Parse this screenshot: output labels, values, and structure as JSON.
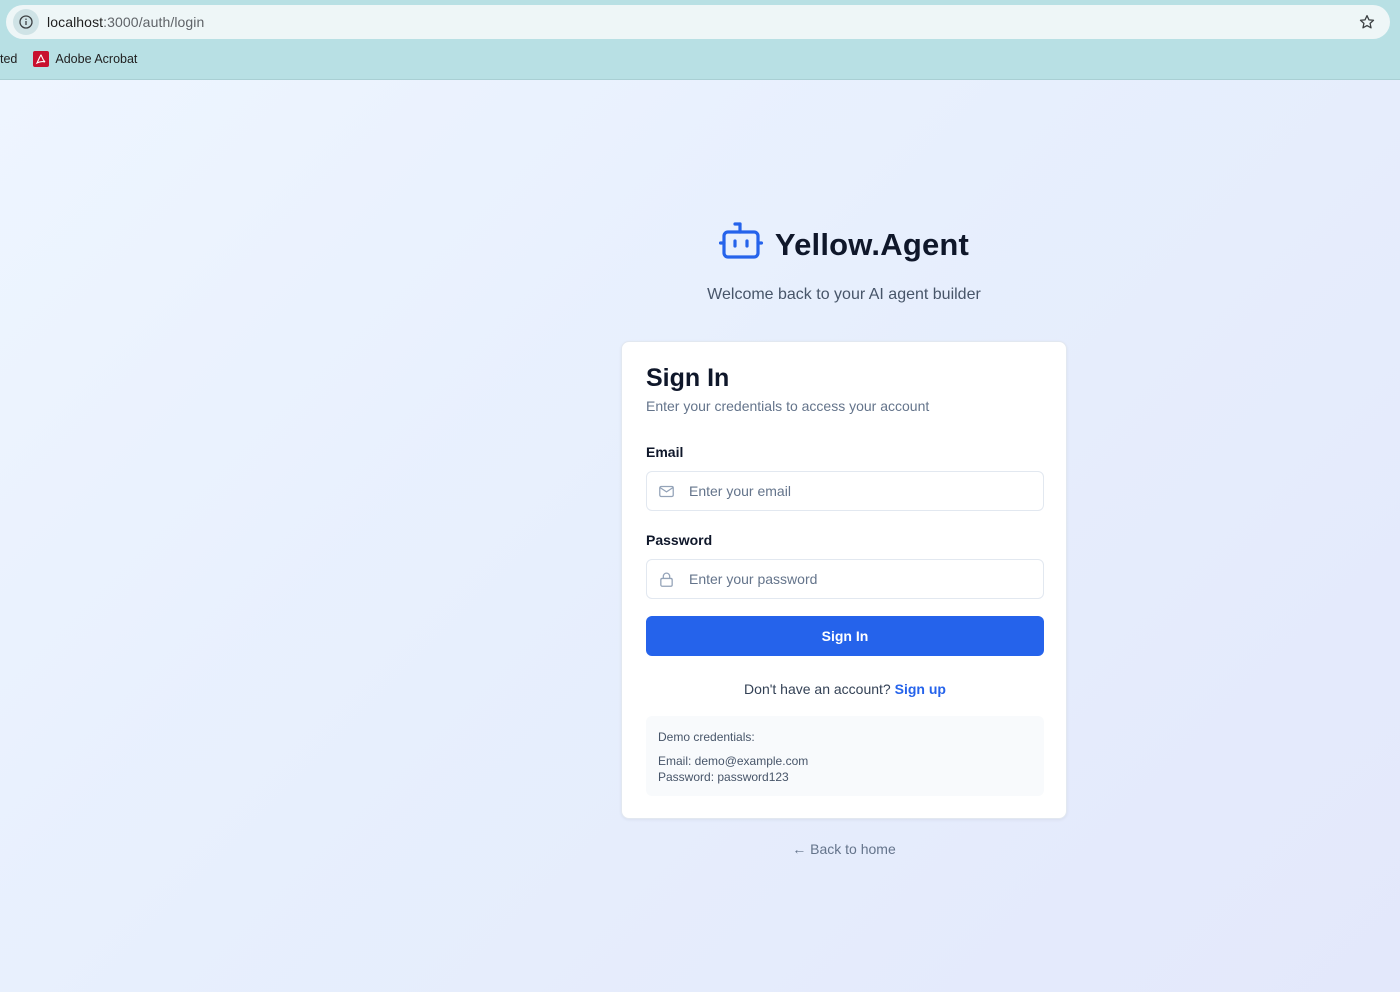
{
  "browser": {
    "url_host": "localhost",
    "url_path": ":3000/auth/login",
    "bookmarks": [
      {
        "label": "ted"
      },
      {
        "label": "Adobe Acrobat"
      }
    ]
  },
  "brand": {
    "title": "Yellow.Agent",
    "tagline": "Welcome back to your AI agent builder",
    "accent_color": "#2563eb",
    "icon": "bot-icon"
  },
  "card": {
    "title": "Sign In",
    "description": "Enter your credentials to access your account",
    "email": {
      "label": "Email",
      "placeholder": "Enter your email",
      "icon": "mail-icon"
    },
    "password": {
      "label": "Password",
      "placeholder": "Enter your password",
      "icon": "lock-icon"
    },
    "submit_label": "Sign In",
    "signup_prompt": "Don't have an account?",
    "signup_link": "Sign up",
    "demo": {
      "title": "Demo credentials:",
      "email_line": "Email: demo@example.com",
      "password_line": "Password: password123"
    }
  },
  "back_link": "← Back to home"
}
